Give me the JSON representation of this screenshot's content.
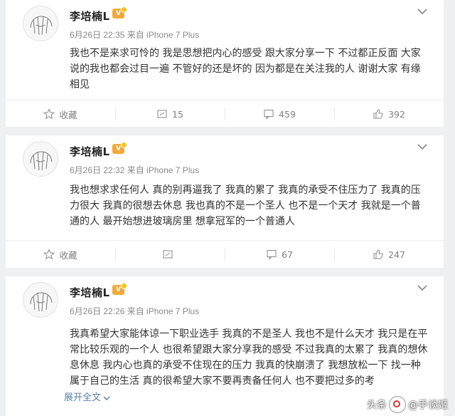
{
  "posts": [
    {
      "user": "李培楠L",
      "meta": "6月26日 22:35 来自 iPhone 7 Plus",
      "content": "我也不是来求可怜的 我是思想把内心的感受 跟大家分享一下 不过都正反面 大家说的我也都会过目一遍 不管好的还是坏的 因为都是在关注我的人 谢谢大家 有缘相见",
      "actions": {
        "fav": "收藏",
        "repost": "15",
        "comment": "459",
        "like": "392"
      }
    },
    {
      "user": "李培楠L",
      "meta": "6月26日 22:32 来自 iPhone 7 Plus",
      "content": "我也想求求任何人 真的别再逼我了 我真的累了 我真的承受不住压力了 我真的压力很大 我真的很想去休息 我也真的不是一个圣人 也不是一个天才 我就是一个普通的人 最开始想进玻璃房里 想拿冠军的一个普通人",
      "actions": {
        "fav": "收藏",
        "repost": "",
        "comment": "67",
        "like": "247"
      }
    },
    {
      "user": "李培楠L",
      "meta": "6月26日 22:26 来自 iPhone 7 Plus",
      "content": "我真希望大家能体谅一下职业选手 我真的不是圣人 我也不是什么天才 我只是在平常比较乐观的一个人 也很希望跟大家分享我的感受 不过我真的太累了 我真的想休息休息 我内心也真的承受不住现在的压力 我真的快崩溃了 我想放松一下 找一种属于自己的生活 真的很希望大家不要再责备任何人 也不要把过多的考",
      "expand": "展开全文"
    }
  ],
  "watermark": {
    "prefix": "头条",
    "name": "@手谈姬"
  },
  "colors": {
    "badge": "#f2a93b",
    "link": "#5b7fa6",
    "bg": "#eef0f2"
  }
}
